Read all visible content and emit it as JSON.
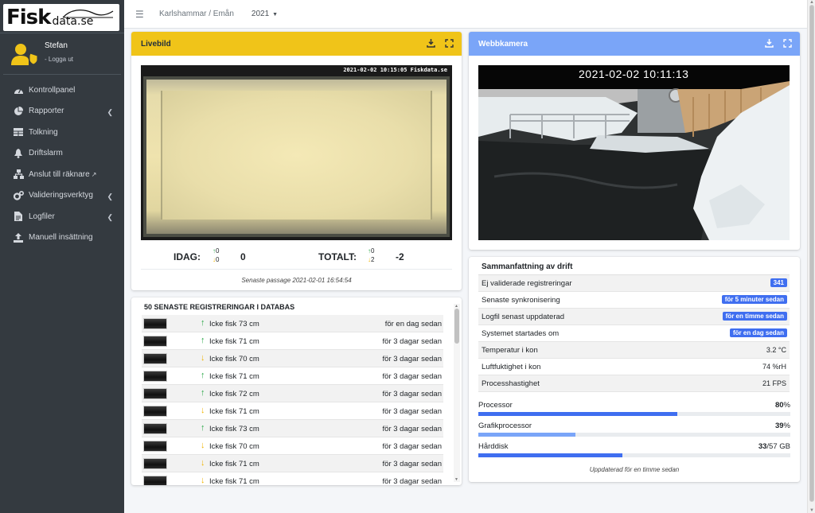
{
  "brand": {
    "logo_main": "Fisk",
    "logo_sub": "data.se"
  },
  "user": {
    "name": "Stefan",
    "logout": "- Logga ut"
  },
  "sidebar": {
    "items": [
      {
        "label": "Kontrollpanel",
        "icon": "dashboard-icon",
        "caret": false,
        "external": false
      },
      {
        "label": "Rapporter",
        "icon": "pie-chart-icon",
        "caret": true,
        "external": false
      },
      {
        "label": "Tolkning",
        "icon": "table-icon",
        "caret": false,
        "external": false
      },
      {
        "label": "Driftslarm",
        "icon": "bell-icon",
        "caret": false,
        "external": false
      },
      {
        "label": "Anslut till räknare",
        "icon": "network-icon",
        "caret": false,
        "external": true
      },
      {
        "label": "Valideringsverktyg",
        "icon": "cogs-icon",
        "caret": true,
        "external": false
      },
      {
        "label": "Logfiler",
        "icon": "file-icon",
        "caret": true,
        "external": false
      },
      {
        "label": "Manuell insättning",
        "icon": "upload-icon",
        "caret": false,
        "external": false
      }
    ]
  },
  "topbar": {
    "breadcrumb": "Karlshammar / Emån",
    "year": "2021"
  },
  "livebild": {
    "title": "Livebild",
    "timestamp": "2021-02-02 10:15:05 Fiskdata.se",
    "idag_label": "IDAG:",
    "idag_up": "0",
    "idag_down": "0",
    "idag_total": "0",
    "totalt_label": "TOTALT:",
    "totalt_up": "0",
    "totalt_down": "2",
    "totalt_total": "-2",
    "footer": "Senaste passage 2021-02-01 16:54:54"
  },
  "webcam": {
    "title": "Webbkamera",
    "timestamp": "2021-02-02 10:11:13"
  },
  "registrations": {
    "title": "50 SENASTE REGISTRERINGAR I DATABAS",
    "rows": [
      {
        "dir": "up",
        "label": "Icke fisk 73 cm",
        "time": "för en dag sedan"
      },
      {
        "dir": "up",
        "label": "Icke fisk 71 cm",
        "time": "för 3 dagar sedan"
      },
      {
        "dir": "down",
        "label": "Icke fisk 70 cm",
        "time": "för 3 dagar sedan"
      },
      {
        "dir": "up",
        "label": "Icke fisk 71 cm",
        "time": "för 3 dagar sedan"
      },
      {
        "dir": "up",
        "label": "Icke fisk 72 cm",
        "time": "för 3 dagar sedan"
      },
      {
        "dir": "down",
        "label": "Icke fisk 71 cm",
        "time": "för 3 dagar sedan"
      },
      {
        "dir": "up",
        "label": "Icke fisk 73 cm",
        "time": "för 3 dagar sedan"
      },
      {
        "dir": "down",
        "label": "Icke fisk 70 cm",
        "time": "för 3 dagar sedan"
      },
      {
        "dir": "down",
        "label": "Icke fisk 71 cm",
        "time": "för 3 dagar sedan"
      },
      {
        "dir": "down",
        "label": "Icke fisk 71 cm",
        "time": "för 3 dagar sedan"
      }
    ]
  },
  "summary": {
    "title": "Sammanfattning av drift",
    "rows": [
      {
        "label": "Ej validerade registreringar",
        "value": "341",
        "badge": true
      },
      {
        "label": "Senaste synkronisering",
        "value": "för 5 minuter sedan",
        "badge": true
      },
      {
        "label": "Logfil senast uppdaterad",
        "value": "för en timme sedan",
        "badge": true
      },
      {
        "label": "Systemet startades om",
        "value": "för en dag sedan",
        "badge": true
      },
      {
        "label": "Temperatur i kon",
        "value": "3.2 °C",
        "badge": false
      },
      {
        "label": "Luftfuktighet i kon",
        "value": "74 %rH",
        "badge": false
      },
      {
        "label": "Processhastighet",
        "value": "21 FPS",
        "badge": false
      }
    ],
    "meters": [
      {
        "label": "Processor",
        "value_bold": "80",
        "value_rest": "%",
        "fraction": 0.8,
        "color": "#3f6ef0"
      },
      {
        "label": "Grafikprocessor",
        "value_bold": "39",
        "value_rest": "%",
        "fraction": 0.39,
        "color": "#7aa5f8"
      },
      {
        "label": "Hårddisk",
        "value_bold": "33",
        "value_rest": "/57 GB",
        "fraction": 0.579,
        "color": "#3f6ef0"
      }
    ],
    "footer": "Uppdaterad för en timme sedan"
  },
  "colors": {
    "sidebar": "#343a40",
    "live_header": "#f0c419",
    "cam_header": "#7aa5f8",
    "badge": "#3f6ef0",
    "arrow_up": "#28a745",
    "arrow_down": "#f0b400"
  }
}
